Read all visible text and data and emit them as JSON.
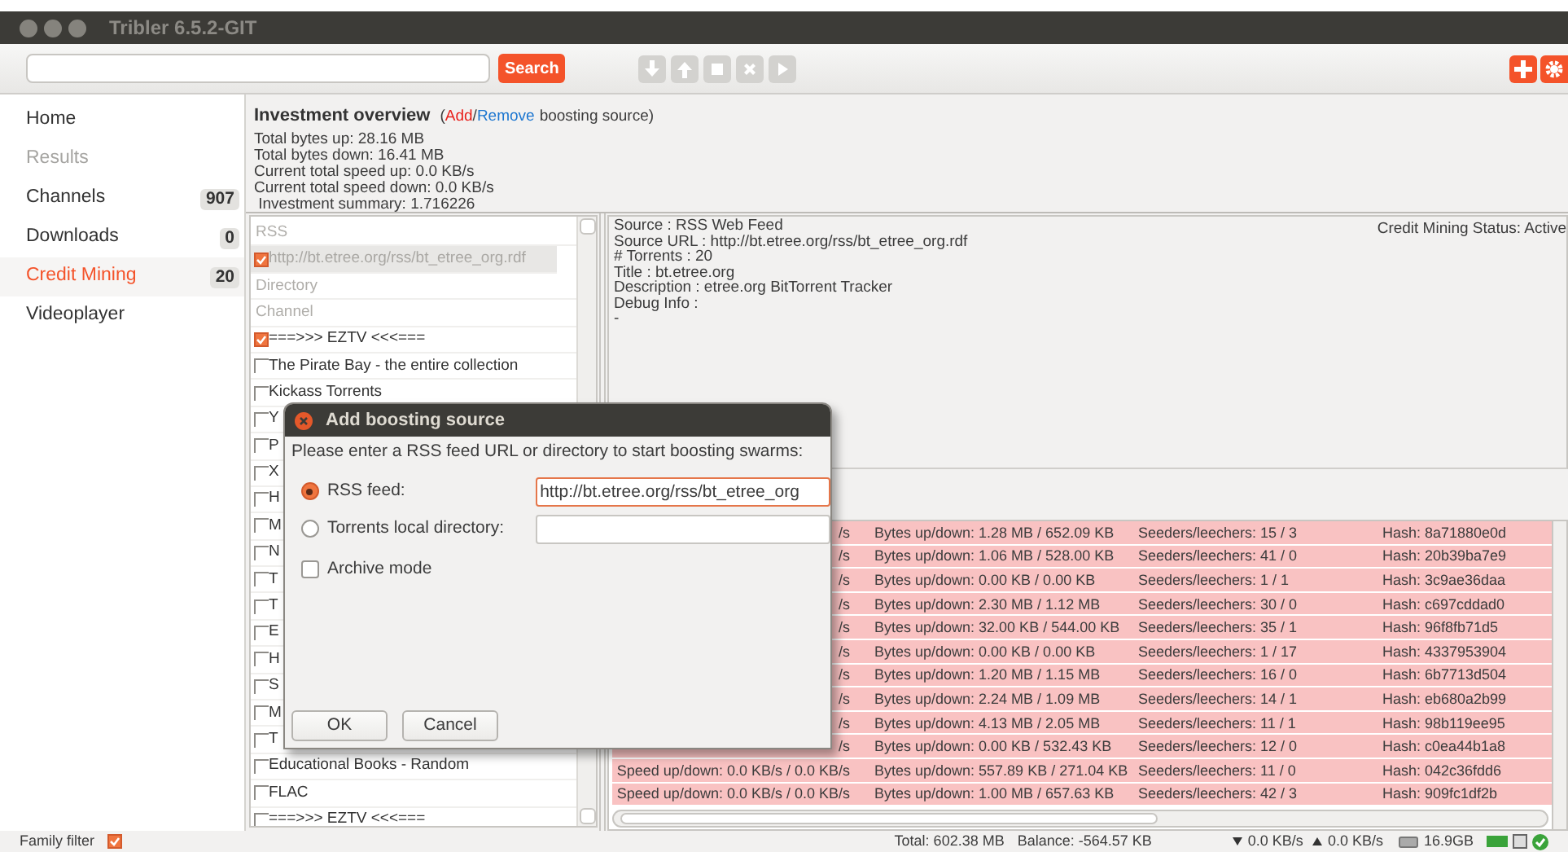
{
  "window": {
    "title": "Tribler 6.5.2-GIT"
  },
  "toolbar": {
    "search_button": "Search",
    "transfer_buttons": [
      {
        "disabled": true
      },
      {
        "disabled": true
      },
      {
        "disabled": true
      },
      {
        "disabled": true
      },
      {
        "disabled": true
      }
    ]
  },
  "sidebar": {
    "items": [
      {
        "label": "Home",
        "selected": false,
        "disabled": false
      },
      {
        "label": "Results",
        "selected": false,
        "disabled": true
      },
      {
        "label": "Channels",
        "count": "907",
        "selected": false,
        "disabled": false
      },
      {
        "label": "Downloads",
        "count": "0",
        "selected": false,
        "disabled": false
      },
      {
        "label": "Credit Mining",
        "count": "20",
        "selected": true,
        "disabled": false
      },
      {
        "label": "Videoplayer",
        "selected": false,
        "disabled": false
      }
    ]
  },
  "overview": {
    "title": "Investment overview",
    "open": "(",
    "add": "Add",
    "slash": "/",
    "remove": "Remove",
    "rest": "boosting source)",
    "lines": [
      "Total bytes up: 28.16 MB",
      "Total bytes down: 16.41 MB",
      "Current total speed up: 0.0 KB/s",
      "Current total speed down: 0.0 KB/s",
      " Investment summary: 1.716226"
    ]
  },
  "sources": [
    {
      "kind": "header",
      "label": "RSS"
    },
    {
      "kind": "item",
      "label": "http://bt.etree.org/rss/bt_etree_org.rdf",
      "checked": true,
      "selected": true
    },
    {
      "kind": "header",
      "label": "Directory"
    },
    {
      "kind": "header",
      "label": "Channel"
    },
    {
      "kind": "item",
      "label": "===>>> EZTV <<<===",
      "checked": true,
      "selected": false
    },
    {
      "kind": "item",
      "label": "The Pirate Bay - the entire collection",
      "checked": false,
      "selected": false
    },
    {
      "kind": "item",
      "label": "Kickass Torrents",
      "checked": false,
      "selected": false
    },
    {
      "kind": "item",
      "label": "Y",
      "checked": false,
      "selected": false
    },
    {
      "kind": "item",
      "label": "P",
      "checked": false,
      "selected": false
    },
    {
      "kind": "item",
      "label": "X",
      "checked": false,
      "selected": false
    },
    {
      "kind": "item",
      "label": "H",
      "checked": false,
      "selected": false
    },
    {
      "kind": "item",
      "label": "M",
      "checked": false,
      "selected": false
    },
    {
      "kind": "item",
      "label": "N",
      "checked": false,
      "selected": false
    },
    {
      "kind": "item",
      "label": "T",
      "checked": false,
      "selected": false
    },
    {
      "kind": "item",
      "label": "T",
      "checked": false,
      "selected": false
    },
    {
      "kind": "item",
      "label": "E",
      "checked": false,
      "selected": false
    },
    {
      "kind": "item",
      "label": "H",
      "checked": false,
      "selected": false
    },
    {
      "kind": "item",
      "label": "S",
      "checked": false,
      "selected": false
    },
    {
      "kind": "item",
      "label": "M",
      "checked": false,
      "selected": false
    },
    {
      "kind": "item",
      "label": "T",
      "checked": false,
      "selected": false
    },
    {
      "kind": "item",
      "label": "Educational Books - Random",
      "checked": false,
      "selected": false
    },
    {
      "kind": "item",
      "label": "FLAC",
      "checked": false,
      "selected": false
    },
    {
      "kind": "item",
      "label": "===>>> EZTV <<<===",
      "checked": false,
      "selected": false
    }
  ],
  "info": {
    "lines": [
      "Source : RSS Web Feed",
      "Source URL : http://bt.etree.org/rss/bt_etree_org.rdf",
      "# Torrents : 20",
      "Title : bt.etree.org",
      "Description : etree.org BitTorrent Tracker",
      "Debug Info :",
      "-"
    ],
    "status": "Credit Mining Status: Active"
  },
  "table": {
    "rows": [
      {
        "speed": "/s",
        "bytes": "Bytes up/down: 1.28 MB / 652.09 KB",
        "peers": "Seeders/leechers: 15 / 3",
        "hash": "Hash: 8a71880e0d"
      },
      {
        "speed": "/s",
        "bytes": "Bytes up/down: 1.06 MB / 528.00 KB",
        "peers": "Seeders/leechers: 41 / 0",
        "hash": "Hash: 20b39ba7e9"
      },
      {
        "speed": "/s",
        "bytes": "Bytes up/down: 0.00 KB / 0.00 KB",
        "peers": "Seeders/leechers: 1 / 1",
        "hash": "Hash: 3c9ae36daa"
      },
      {
        "speed": "/s",
        "bytes": "Bytes up/down: 2.30 MB / 1.12 MB",
        "peers": "Seeders/leechers: 30 / 0",
        "hash": "Hash: c697cddad0"
      },
      {
        "speed": "/s",
        "bytes": "Bytes up/down: 32.00 KB / 544.00 KB",
        "peers": "Seeders/leechers: 35 / 1",
        "hash": "Hash: 96f8fb71d5"
      },
      {
        "speed": "/s",
        "bytes": "Bytes up/down: 0.00 KB / 0.00 KB",
        "peers": "Seeders/leechers: 1 / 17",
        "hash": "Hash: 4337953904"
      },
      {
        "speed": "/s",
        "bytes": "Bytes up/down: 1.20 MB / 1.15 MB",
        "peers": "Seeders/leechers: 16 / 0",
        "hash": "Hash: 6b7713d504"
      },
      {
        "speed": "/s",
        "bytes": "Bytes up/down: 2.24 MB / 1.09 MB",
        "peers": "Seeders/leechers: 14 / 1",
        "hash": "Hash: eb680a2b99"
      },
      {
        "speed": "/s",
        "bytes": "Bytes up/down: 4.13 MB / 2.05 MB",
        "peers": "Seeders/leechers: 11 / 1",
        "hash": "Hash: 98b119ee95"
      },
      {
        "speed": "/s",
        "bytes": "Bytes up/down: 0.00 KB / 532.43 KB",
        "peers": "Seeders/leechers: 12 / 0",
        "hash": "Hash: c0ea44b1a8"
      },
      {
        "speed": "Speed up/down: 0.0 KB/s / 0.0 KB/s",
        "bytes": "Bytes up/down: 557.89 KB / 271.04 KB",
        "peers": "Seeders/leechers: 11 / 0",
        "hash": "Hash: 042c36fdd6"
      },
      {
        "speed": "Speed up/down: 0.0 KB/s / 0.0 KB/s",
        "bytes": "Bytes up/down: 1.00 MB / 657.63 KB",
        "peers": "Seeders/leechers: 42 / 3",
        "hash": "Hash: 909fc1df2b"
      }
    ]
  },
  "dialog": {
    "title": "Add boosting source",
    "prompt": "Please enter a RSS feed URL or directory to start boosting swarms:",
    "options": [
      {
        "label": "RSS feed:",
        "selected": true,
        "value": "http://bt.etree.org/rss/bt_etree_org"
      },
      {
        "label": "Torrents local directory:",
        "selected": false
      }
    ],
    "archive": {
      "label": "Archive mode",
      "checked": false
    },
    "buttons": [
      "OK",
      "Cancel"
    ]
  },
  "status_bar": {
    "family_filter": {
      "label": "Family filter",
      "checked": true
    },
    "total": "Total: 602.38 MB",
    "balance": "Balance: -564.57 KB",
    "down": "0.0 KB/s",
    "up": "0.0 KB/s",
    "disk": "16.9GB"
  }
}
